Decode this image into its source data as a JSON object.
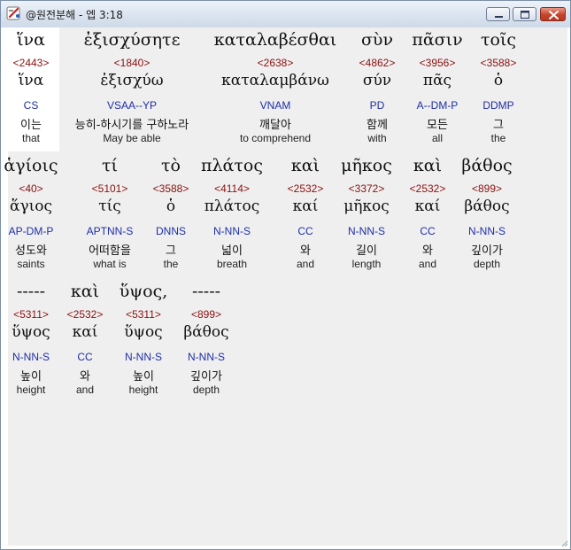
{
  "window": {
    "title": "@원전분해 - 엡 3:18",
    "buttons": {
      "minimize": "minimize",
      "maximize": "maximize",
      "close": "close"
    }
  },
  "rows": [
    {
      "words": [
        {
          "greek": "ἵνα",
          "strong": "<2443>",
          "lemma": "ἵνα",
          "parse": "CS",
          "korean": "이는",
          "english": "that"
        },
        {
          "greek": "ἐξισχύσητε",
          "strong": "<1840>",
          "lemma": "ἐξισχύω",
          "parse": "VSAA--YP",
          "korean": "능히-하시기를 구하노라",
          "english": "May be able"
        },
        {
          "greek": "καταλαβέσθαι",
          "strong": "<2638>",
          "lemma": "καταλαμβάνω",
          "parse": "VNAM",
          "korean": "깨달아",
          "english": "to comprehend"
        },
        {
          "greek": "σὺν",
          "strong": "<4862>",
          "lemma": "σύν",
          "parse": "PD",
          "korean": "함께",
          "english": "with"
        },
        {
          "greek": "πᾶσιν",
          "strong": "<3956>",
          "lemma": "πᾶς",
          "parse": "A--DM-P",
          "korean": "모든",
          "english": "all"
        },
        {
          "greek": "τοῖς",
          "strong": "<3588>",
          "lemma": "ὁ",
          "parse": "DDMP",
          "korean": "그",
          "english": "the"
        }
      ]
    },
    {
      "words": [
        {
          "greek": "ἁγίοις",
          "strong": "<40>",
          "lemma": "ἅγιος",
          "parse": "AP-DM-P",
          "korean": "성도와",
          "english": "saints"
        },
        {
          "greek": "τί",
          "strong": "<5101>",
          "lemma": "τίς",
          "parse": "APTNN-S",
          "korean": "어떠함을",
          "english": "what is"
        },
        {
          "greek": "τὸ",
          "strong": "<3588>",
          "lemma": "ὁ",
          "parse": "DNNS",
          "korean": "그",
          "english": "the"
        },
        {
          "greek": "πλάτος",
          "strong": "<4114>",
          "lemma": "πλάτος",
          "parse": "N-NN-S",
          "korean": "넓이",
          "english": "breath"
        },
        {
          "greek": "καὶ",
          "strong": "<2532>",
          "lemma": "καί",
          "parse": "CC",
          "korean": "와",
          "english": "and"
        },
        {
          "greek": "μῆκος",
          "strong": "<3372>",
          "lemma": "μῆκος",
          "parse": "N-NN-S",
          "korean": "길이",
          "english": "length"
        },
        {
          "greek": "καὶ",
          "strong": "<2532>",
          "lemma": "καί",
          "parse": "CC",
          "korean": "와",
          "english": "and"
        },
        {
          "greek": "βάθος",
          "strong": "<899>",
          "lemma": "βάθος",
          "parse": "N-NN-S",
          "korean": "깊이가",
          "english": "depth"
        }
      ]
    },
    {
      "words": [
        {
          "greek": "-----",
          "strong": "<5311>",
          "lemma": "ὕψος",
          "parse": "N-NN-S",
          "korean": "높이",
          "english": "height"
        },
        {
          "greek": "καὶ",
          "strong": "<2532>",
          "lemma": "καί",
          "parse": "CC",
          "korean": "와",
          "english": "and"
        },
        {
          "greek": "ὕψος,",
          "strong": "<5311>",
          "lemma": "ὕψος",
          "parse": "N-NN-S",
          "korean": "높이",
          "english": "height"
        },
        {
          "greek": "-----",
          "strong": "<899>",
          "lemma": "βάθος",
          "parse": "N-NN-S",
          "korean": "깊이가",
          "english": "depth"
        }
      ]
    }
  ]
}
